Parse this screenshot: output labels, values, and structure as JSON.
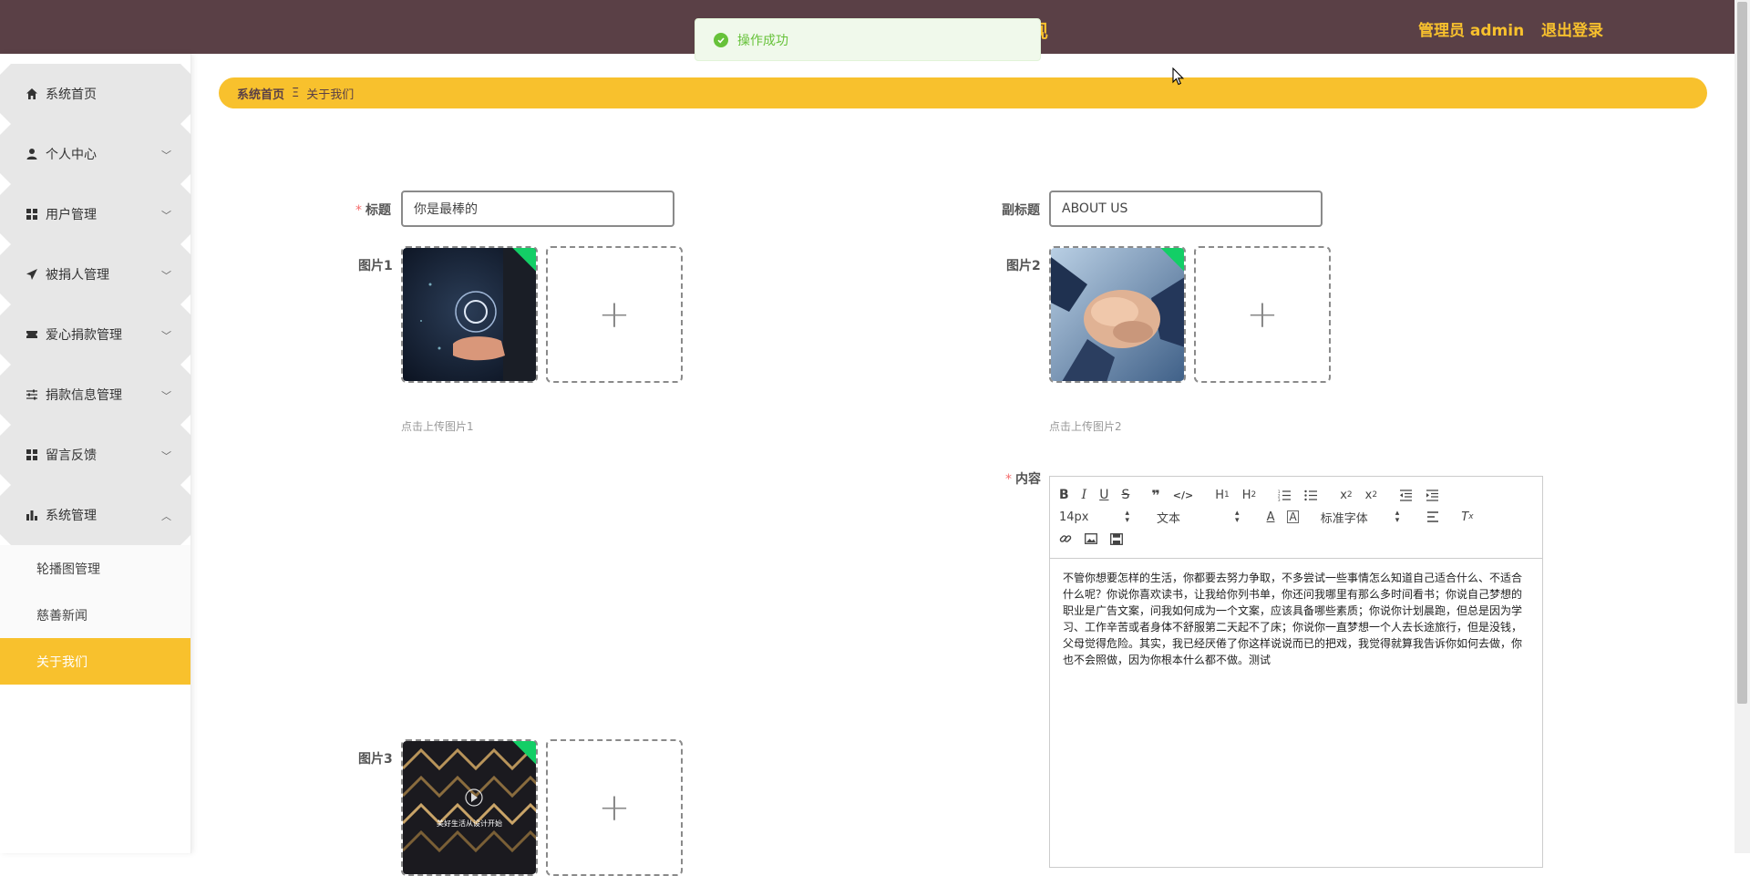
{
  "header": {
    "title_partial": "现",
    "user_label": "管理员 admin",
    "logout_label": "退出登录"
  },
  "toast": {
    "message": "操作成功"
  },
  "sidebar": {
    "items": [
      {
        "label": "系统首页",
        "icon": "home-icon"
      },
      {
        "label": "个人中心",
        "icon": "user-icon"
      },
      {
        "label": "用户管理",
        "icon": "grid-icon"
      },
      {
        "label": "被捐人管理",
        "icon": "paper-plane-icon"
      },
      {
        "label": "爱心捐款管理",
        "icon": "ticket-icon"
      },
      {
        "label": "捐款信息管理",
        "icon": "sliders-icon"
      },
      {
        "label": "留言反馈",
        "icon": "grid-icon"
      },
      {
        "label": "系统管理",
        "icon": "bar-chart-icon"
      }
    ],
    "sub_items": [
      {
        "label": "轮播图管理"
      },
      {
        "label": "慈善新闻"
      },
      {
        "label": "关于我们"
      }
    ]
  },
  "breadcrumb": {
    "home": "系统首页",
    "separator": "Ξ",
    "current": "关于我们"
  },
  "form": {
    "title_label": "标题",
    "title_value": "你是最棒的",
    "subtitle_label": "副标题",
    "subtitle_value": "ABOUT US",
    "pic1_label": "图片1",
    "pic1_tip": "点击上传图片1",
    "pic2_label": "图片2",
    "pic2_tip": "点击上传图片2",
    "pic3_label": "图片3",
    "pic3_overlay": "美好生活从设计开始",
    "content_label": "内容",
    "plus": "+"
  },
  "editor": {
    "font_size": "14px",
    "block_format": "文本",
    "font_family": "标准字体",
    "content": "不管你想要怎样的生活，你都要去努力争取，不多尝试一些事情怎么知道自己适合什么、不适合什么呢？你说你喜欢读书，让我给你列书单，你还问我哪里有那么多时间看书；你说自己梦想的职业是广告文案，问我如何成为一个文案，应该具备哪些素质；你说你计划晨跑，但总是因为学习、工作辛苦或者身体不舒服第二天起不了床；你说你一直梦想一个人去长途旅行，但是没钱，父母觉得危险。其实，我已经厌倦了你这样说说而已的把戏，我觉得就算我告诉你如何去做，你也不会照做，因为你根本什么都不做。测试"
  },
  "colors": {
    "header_bg": "#5a4046",
    "accent": "#f8c12d",
    "success": "#67c23a",
    "corner_badge": "#13ce66",
    "required": "#f56c6c"
  }
}
